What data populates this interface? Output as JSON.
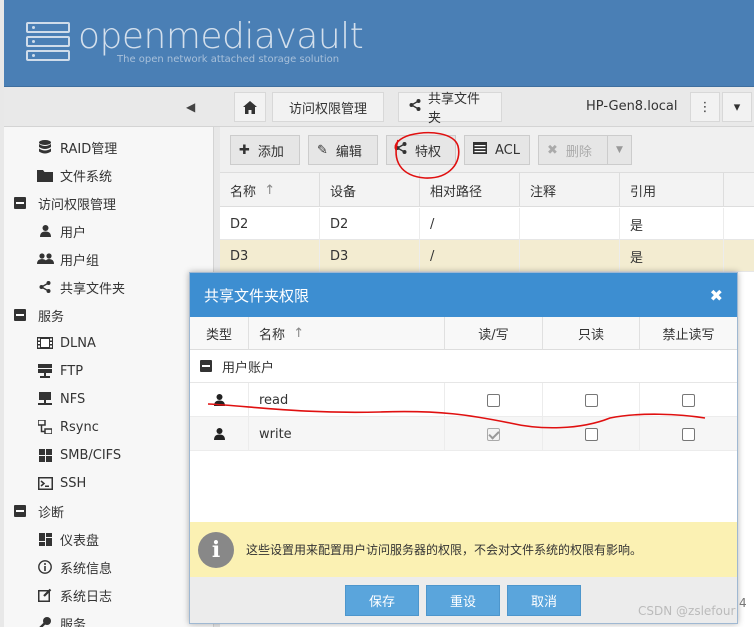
{
  "header": {
    "logo_text": "openmediavault",
    "tagline": "The open network attached storage solution"
  },
  "breadcrumb": {
    "item1": "访问权限管理",
    "item2": "共享文件夹",
    "hostname": "HP-Gen8.local"
  },
  "sidebar": {
    "items": [
      {
        "label": "RAID管理",
        "icon": "database-icon",
        "level": "sub"
      },
      {
        "label": "文件系统",
        "icon": "folder-icon",
        "level": "sub"
      },
      {
        "label": "访问权限管理",
        "icon": "collapse-icon",
        "level": "group"
      },
      {
        "label": "用户",
        "icon": "user-icon",
        "level": "sub"
      },
      {
        "label": "用户组",
        "icon": "users-icon",
        "level": "sub"
      },
      {
        "label": "共享文件夹",
        "icon": "share-icon",
        "level": "sub"
      },
      {
        "label": "服务",
        "icon": "collapse-icon",
        "level": "group"
      },
      {
        "label": "DLNA",
        "icon": "film-icon",
        "level": "sub"
      },
      {
        "label": "FTP",
        "icon": "server-icon",
        "level": "sub"
      },
      {
        "label": "NFS",
        "icon": "network-icon",
        "level": "sub"
      },
      {
        "label": "Rsync",
        "icon": "sync-icon",
        "level": "sub"
      },
      {
        "label": "SMB/CIFS",
        "icon": "windows-icon",
        "level": "sub"
      },
      {
        "label": "SSH",
        "icon": "terminal-icon",
        "level": "sub"
      },
      {
        "label": "诊断",
        "icon": "collapse-icon",
        "level": "group"
      },
      {
        "label": "仪表盘",
        "icon": "dashboard-icon",
        "level": "sub"
      },
      {
        "label": "系统信息",
        "icon": "info-icon",
        "level": "sub"
      },
      {
        "label": "系统日志",
        "icon": "edit-icon",
        "level": "sub"
      },
      {
        "label": "服务",
        "icon": "wrench-icon",
        "level": "sub"
      }
    ]
  },
  "toolbar": {
    "add": "添加",
    "edit": "编辑",
    "privileges": "特权",
    "acl": "ACL",
    "delete": "删除"
  },
  "grid": {
    "columns": [
      "名称",
      "设备",
      "相对路径",
      "注释",
      "引用"
    ],
    "rows": [
      {
        "name": "D2",
        "device": "D2",
        "path": "/",
        "comment": "",
        "ref": "是"
      },
      {
        "name": "D3",
        "device": "D3",
        "path": "/",
        "comment": "",
        "ref": "是"
      }
    ]
  },
  "modal": {
    "title": "共享文件夹权限",
    "columns": {
      "type": "类型",
      "name": "名称",
      "rw": "读/写",
      "ro": "只读",
      "none": "禁止读写"
    },
    "group_label": "用户账户",
    "users": [
      {
        "name": "read",
        "rw": false,
        "ro": false,
        "none": false
      },
      {
        "name": "write",
        "rw": true,
        "ro": false,
        "none": false
      }
    ],
    "info": "这些设置用来配置用户访问服务器的权限，不会对文件系统的权限有影响。",
    "buttons": {
      "save": "保存",
      "reset": "重设",
      "cancel": "取消"
    }
  },
  "watermark": "CSDN @zslefour",
  "edge_text": "4",
  "colors": {
    "header_bg": "#4a7fb5",
    "modal_title_bg": "#3d8ed1",
    "button_bg": "#5aa5dc",
    "info_bg": "#fbf1b3",
    "selected_row": "#f3ecd1",
    "annotation_red": "#e01010"
  }
}
